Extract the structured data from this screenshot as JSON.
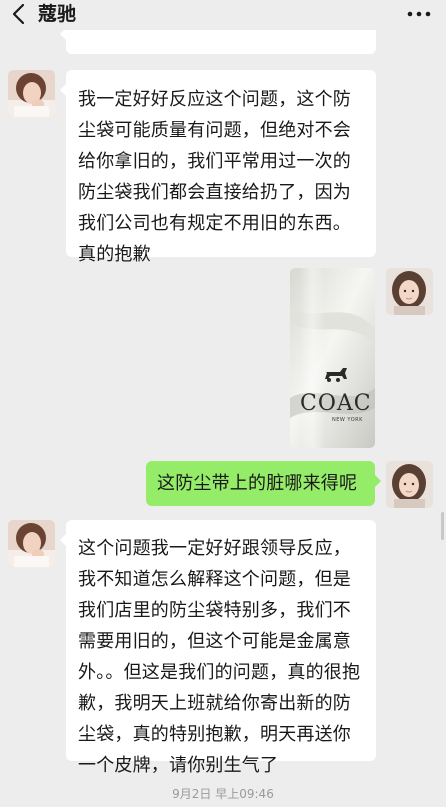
{
  "header": {
    "title": "蔻驰",
    "back_icon": "chevron-left-icon",
    "more_icon": "more-dots-icon"
  },
  "messages": [
    {
      "sender": "other",
      "type": "text",
      "text": "我一定好好反应这个问题，这个防尘袋可能质量有问题，但绝对不会给你拿旧的，我们平常用过一次的防尘袋我们都会直接给扔了，因为我们公司也有规定不用旧的东西。真的抱歉"
    },
    {
      "sender": "me",
      "type": "image",
      "image_text": "COAC",
      "image_subtext": "NEW YORK"
    },
    {
      "sender": "me",
      "type": "text",
      "text": "这防尘带上的脏哪来得呢"
    },
    {
      "sender": "other",
      "type": "text",
      "text": "这个问题我一定好好跟领导反应，我不知道怎么解释这个问题，但是我们店里的防尘袋特别多，我们不需要用旧的，但这个可能是金属意外。。但这是我们的问题，真的很抱歉，我明天上班就给你寄出新的防尘袋，真的特别抱歉，明天再送你一个皮牌，请你别生气了"
    }
  ],
  "timestamp": "9月2日 早上09:46",
  "colors": {
    "background": "#ededed",
    "bubble_me": "#95ec69",
    "bubble_other": "#ffffff"
  }
}
